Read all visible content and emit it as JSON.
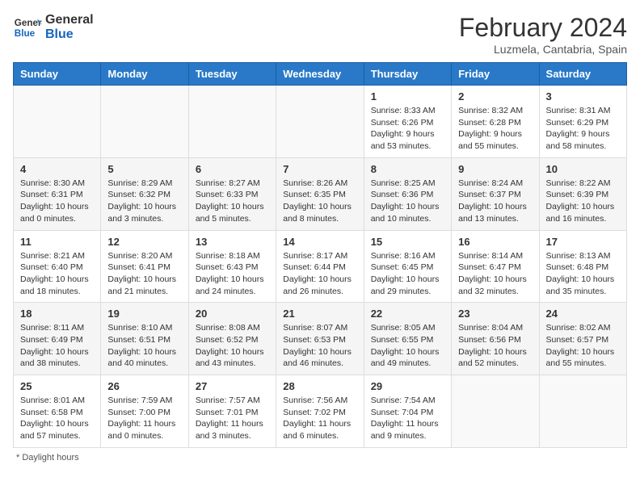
{
  "header": {
    "logo_general": "General",
    "logo_blue": "Blue",
    "month_year": "February 2024",
    "location": "Luzmela, Cantabria, Spain"
  },
  "days_of_week": [
    "Sunday",
    "Monday",
    "Tuesday",
    "Wednesday",
    "Thursday",
    "Friday",
    "Saturday"
  ],
  "weeks": [
    [
      {
        "day": "",
        "sunrise": "",
        "sunset": "",
        "daylight": "",
        "empty": true
      },
      {
        "day": "",
        "sunrise": "",
        "sunset": "",
        "daylight": "",
        "empty": true
      },
      {
        "day": "",
        "sunrise": "",
        "sunset": "",
        "daylight": "",
        "empty": true
      },
      {
        "day": "",
        "sunrise": "",
        "sunset": "",
        "daylight": "",
        "empty": true
      },
      {
        "day": "1",
        "sunrise": "8:33 AM",
        "sunset": "6:26 PM",
        "daylight": "9 hours and 53 minutes."
      },
      {
        "day": "2",
        "sunrise": "8:32 AM",
        "sunset": "6:28 PM",
        "daylight": "9 hours and 55 minutes."
      },
      {
        "day": "3",
        "sunrise": "8:31 AM",
        "sunset": "6:29 PM",
        "daylight": "9 hours and 58 minutes."
      }
    ],
    [
      {
        "day": "4",
        "sunrise": "8:30 AM",
        "sunset": "6:31 PM",
        "daylight": "10 hours and 0 minutes."
      },
      {
        "day": "5",
        "sunrise": "8:29 AM",
        "sunset": "6:32 PM",
        "daylight": "10 hours and 3 minutes."
      },
      {
        "day": "6",
        "sunrise": "8:27 AM",
        "sunset": "6:33 PM",
        "daylight": "10 hours and 5 minutes."
      },
      {
        "day": "7",
        "sunrise": "8:26 AM",
        "sunset": "6:35 PM",
        "daylight": "10 hours and 8 minutes."
      },
      {
        "day": "8",
        "sunrise": "8:25 AM",
        "sunset": "6:36 PM",
        "daylight": "10 hours and 10 minutes."
      },
      {
        "day": "9",
        "sunrise": "8:24 AM",
        "sunset": "6:37 PM",
        "daylight": "10 hours and 13 minutes."
      },
      {
        "day": "10",
        "sunrise": "8:22 AM",
        "sunset": "6:39 PM",
        "daylight": "10 hours and 16 minutes."
      }
    ],
    [
      {
        "day": "11",
        "sunrise": "8:21 AM",
        "sunset": "6:40 PM",
        "daylight": "10 hours and 18 minutes."
      },
      {
        "day": "12",
        "sunrise": "8:20 AM",
        "sunset": "6:41 PM",
        "daylight": "10 hours and 21 minutes."
      },
      {
        "day": "13",
        "sunrise": "8:18 AM",
        "sunset": "6:43 PM",
        "daylight": "10 hours and 24 minutes."
      },
      {
        "day": "14",
        "sunrise": "8:17 AM",
        "sunset": "6:44 PM",
        "daylight": "10 hours and 26 minutes."
      },
      {
        "day": "15",
        "sunrise": "8:16 AM",
        "sunset": "6:45 PM",
        "daylight": "10 hours and 29 minutes."
      },
      {
        "day": "16",
        "sunrise": "8:14 AM",
        "sunset": "6:47 PM",
        "daylight": "10 hours and 32 minutes."
      },
      {
        "day": "17",
        "sunrise": "8:13 AM",
        "sunset": "6:48 PM",
        "daylight": "10 hours and 35 minutes."
      }
    ],
    [
      {
        "day": "18",
        "sunrise": "8:11 AM",
        "sunset": "6:49 PM",
        "daylight": "10 hours and 38 minutes."
      },
      {
        "day": "19",
        "sunrise": "8:10 AM",
        "sunset": "6:51 PM",
        "daylight": "10 hours and 40 minutes."
      },
      {
        "day": "20",
        "sunrise": "8:08 AM",
        "sunset": "6:52 PM",
        "daylight": "10 hours and 43 minutes."
      },
      {
        "day": "21",
        "sunrise": "8:07 AM",
        "sunset": "6:53 PM",
        "daylight": "10 hours and 46 minutes."
      },
      {
        "day": "22",
        "sunrise": "8:05 AM",
        "sunset": "6:55 PM",
        "daylight": "10 hours and 49 minutes."
      },
      {
        "day": "23",
        "sunrise": "8:04 AM",
        "sunset": "6:56 PM",
        "daylight": "10 hours and 52 minutes."
      },
      {
        "day": "24",
        "sunrise": "8:02 AM",
        "sunset": "6:57 PM",
        "daylight": "10 hours and 55 minutes."
      }
    ],
    [
      {
        "day": "25",
        "sunrise": "8:01 AM",
        "sunset": "6:58 PM",
        "daylight": "10 hours and 57 minutes."
      },
      {
        "day": "26",
        "sunrise": "7:59 AM",
        "sunset": "7:00 PM",
        "daylight": "11 hours and 0 minutes."
      },
      {
        "day": "27",
        "sunrise": "7:57 AM",
        "sunset": "7:01 PM",
        "daylight": "11 hours and 3 minutes."
      },
      {
        "day": "28",
        "sunrise": "7:56 AM",
        "sunset": "7:02 PM",
        "daylight": "11 hours and 6 minutes."
      },
      {
        "day": "29",
        "sunrise": "7:54 AM",
        "sunset": "7:04 PM",
        "daylight": "11 hours and 9 minutes."
      },
      {
        "day": "",
        "sunrise": "",
        "sunset": "",
        "daylight": "",
        "empty": true
      },
      {
        "day": "",
        "sunrise": "",
        "sunset": "",
        "daylight": "",
        "empty": true
      }
    ]
  ],
  "footer": {
    "daylight_label": "Daylight hours"
  }
}
